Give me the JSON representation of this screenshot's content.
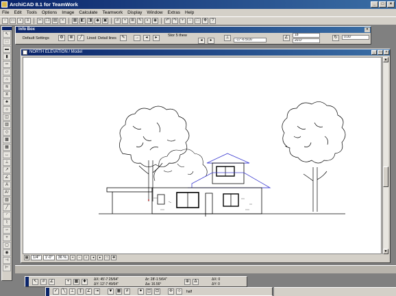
{
  "window": {
    "title": "ArchiCAD 8.1 for TeamWork"
  },
  "menu": [
    "File",
    "Edit",
    "Tools",
    "Options",
    "Image",
    "Calculate",
    "Teamwork",
    "Display",
    "Window",
    "Extras",
    "Help"
  ],
  "infobox": {
    "title": "Info Box",
    "settings_label": "Default Settings",
    "linetype": "Lined",
    "linetype_menu": "Detail lines",
    "story": "Stor 5 thew",
    "height_value": "-17'-6 5/16\"",
    "field_a": "18",
    "field_b": "20.0\"",
    "field_c": "0.00\""
  },
  "drawing_window": {
    "title": "NORTH ELEVATION / Model",
    "scale": "1/4\"",
    "scale_value": "1'-0\"",
    "zoom": "36 %"
  },
  "coord_box": {
    "ax": "ΔX: 45'-7 25/64\"",
    "ay": "ΔY: 12'-7 49/64\"",
    "ar": "Δr: 28'-1 5/64\"",
    "aa": "Δa: 16.56°",
    "ax2": "ΔX: 0",
    "ay2": "ΔY: 0"
  },
  "control_box": {
    "label": "half"
  }
}
